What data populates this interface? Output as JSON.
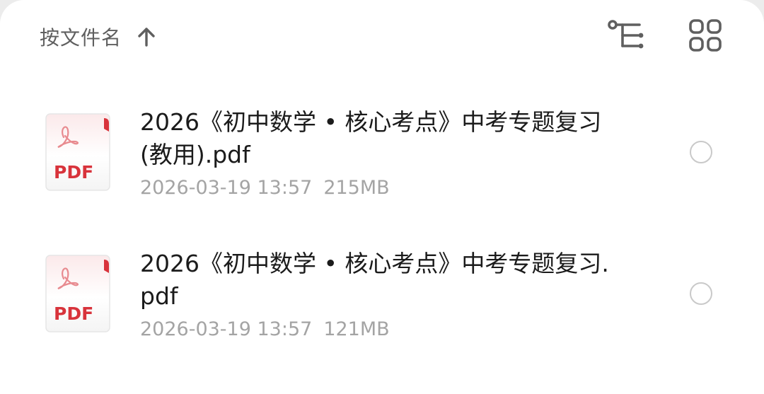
{
  "toolbar": {
    "sort_label": "按文件名",
    "sort_direction_icon": "arrow-up-icon",
    "tree_view_icon": "tree-view-icon",
    "grid_view_icon": "grid-view-icon"
  },
  "colors": {
    "text_primary": "#1b1b1b",
    "text_secondary": "#a4a4a4",
    "icon_gray": "#5f5f5f",
    "pdf_red": "#d8333b",
    "radio_border": "#c9c9c9"
  },
  "files": [
    {
      "name": "2026《初中数学 • 核心考点》中考专题复习(教用).pdf",
      "date": "2026-03-19 13:57",
      "size": "215MB",
      "icon": "pdf-file-icon",
      "icon_label": "PDF"
    },
    {
      "name": "2026《初中数学 • 核心考点》中考专题复习.pdf",
      "date": "2026-03-19 13:57",
      "size": "121MB",
      "icon": "pdf-file-icon",
      "icon_label": "PDF"
    }
  ]
}
